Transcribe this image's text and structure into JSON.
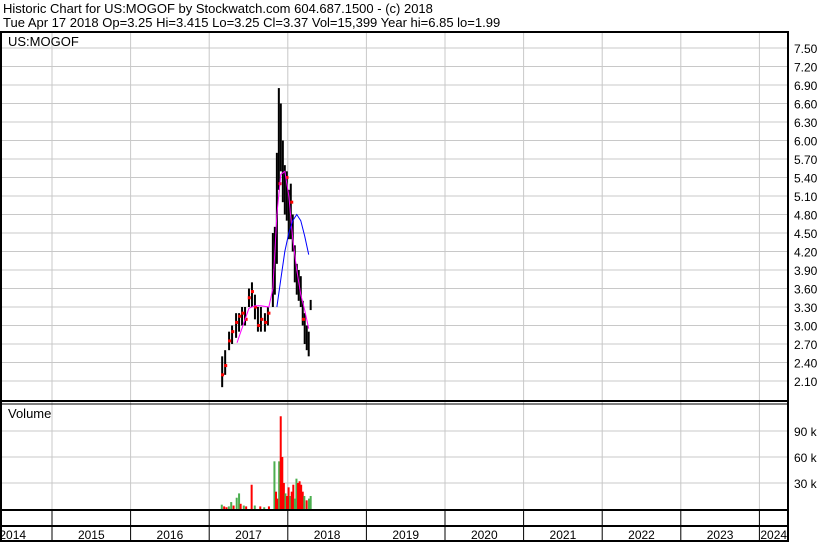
{
  "header": {
    "line1": "Historic Chart for US:MOGOF by Stockwatch.com 604.687.1500 - (c) 2018",
    "line2": "Tue Apr 17 2018  Op=3.25  Hi=3.415  Lo=3.25  Cl=3.37  Vol=15,399  Year hi=6.85  lo=1.99"
  },
  "chart_data": {
    "type": "line",
    "title": "US:MOGOF",
    "volume_title": "Volume",
    "colors": {
      "bar": "#000000",
      "dot": "#ff0000",
      "ma_short": "#ff00ff",
      "ma_long": "#0000ff",
      "vol_up": "#4caf50",
      "vol_down": "#ff0000",
      "grid": "#c8c8c8"
    },
    "price_ticks": [
      "7.50",
      "7.20",
      "6.90",
      "6.60",
      "6.30",
      "6.00",
      "5.70",
      "5.40",
      "5.10",
      "4.80",
      "4.50",
      "4.20",
      "3.90",
      "3.60",
      "3.30",
      "3.00",
      "2.70",
      "2.40",
      "2.10"
    ],
    "price_range": [
      1.95,
      7.5
    ],
    "volume_ticks": [
      {
        "v": 90,
        "label": "90 k"
      },
      {
        "v": 60,
        "label": "60 k"
      },
      {
        "v": 30,
        "label": "30 k"
      }
    ],
    "years": [
      "2014",
      "2015",
      "2016",
      "2017",
      "2018",
      "2019",
      "2020",
      "2021",
      "2022",
      "2023",
      "2024"
    ],
    "x_range": [
      2014.0,
      2024.35
    ],
    "price_bars": [
      [
        2017.165,
        2.5,
        2.0
      ],
      [
        2017.203,
        2.6,
        2.2
      ],
      [
        2017.253,
        2.9,
        2.6
      ],
      [
        2017.291,
        3.0,
        2.7
      ],
      [
        2017.342,
        3.2,
        2.8
      ],
      [
        2017.38,
        3.2,
        2.9
      ],
      [
        2017.418,
        3.3,
        3.0
      ],
      [
        2017.456,
        3.3,
        3.0
      ],
      [
        2017.506,
        3.6,
        3.3
      ],
      [
        2017.544,
        3.7,
        3.3
      ],
      [
        2017.582,
        3.5,
        3.1
      ],
      [
        2017.62,
        3.3,
        2.9
      ],
      [
        2017.658,
        3.3,
        2.9
      ],
      [
        2017.709,
        3.2,
        2.9
      ],
      [
        2017.747,
        3.3,
        3.0
      ],
      [
        2017.81,
        4.5,
        3.3
      ],
      [
        2017.835,
        4.6,
        3.5
      ],
      [
        2017.861,
        5.8,
        4.0
      ],
      [
        2017.886,
        6.85,
        5.2
      ],
      [
        2017.911,
        6.6,
        5.5
      ],
      [
        2017.937,
        6.0,
        5.0
      ],
      [
        2017.962,
        5.6,
        4.8
      ],
      [
        2017.987,
        5.5,
        4.7
      ],
      [
        2018.013,
        5.2,
        4.4
      ],
      [
        2018.038,
        5.3,
        4.4
      ],
      [
        2018.063,
        4.8,
        4.2
      ],
      [
        2018.089,
        4.3,
        3.7
      ],
      [
        2018.114,
        4.0,
        3.5
      ],
      [
        2018.139,
        3.9,
        3.4
      ],
      [
        2018.165,
        3.8,
        3.3
      ],
      [
        2018.19,
        3.4,
        3.0
      ],
      [
        2018.215,
        3.2,
        2.7
      ],
      [
        2018.241,
        3.0,
        2.6
      ],
      [
        2018.266,
        2.9,
        2.5
      ],
      [
        2018.291,
        3.415,
        3.25
      ]
    ],
    "red_dots": [
      [
        2017.17,
        2.2
      ],
      [
        2017.21,
        2.35
      ],
      [
        2017.26,
        2.75
      ],
      [
        2017.3,
        2.9
      ],
      [
        2017.35,
        3.05
      ],
      [
        2017.39,
        3.15
      ],
      [
        2017.43,
        3.2
      ],
      [
        2017.47,
        3.1
      ],
      [
        2017.51,
        3.45
      ],
      [
        2017.55,
        3.55
      ],
      [
        2017.59,
        3.3
      ],
      [
        2017.63,
        3.0
      ],
      [
        2017.67,
        3.1
      ],
      [
        2017.72,
        3.05
      ],
      [
        2017.76,
        3.2
      ],
      [
        2017.9,
        5.3
      ],
      [
        2017.99,
        5.4
      ],
      [
        2018.05,
        5.0
      ],
      [
        2018.2,
        3.1
      ]
    ],
    "ma_short": [
      [
        2017.354,
        2.72
      ],
      [
        2017.443,
        3.05
      ],
      [
        2017.506,
        3.28
      ],
      [
        2017.582,
        3.32
      ],
      [
        2017.658,
        3.32
      ],
      [
        2017.759,
        3.3
      ],
      [
        2017.81,
        3.6
      ],
      [
        2017.861,
        4.8
      ],
      [
        2017.911,
        5.45
      ],
      [
        2017.962,
        5.5
      ],
      [
        2018.013,
        5.1
      ],
      [
        2018.063,
        4.4
      ],
      [
        2018.114,
        3.9
      ],
      [
        2018.165,
        3.5
      ],
      [
        2018.215,
        3.25
      ],
      [
        2018.266,
        2.95
      ]
    ],
    "ma_long": [
      [
        2017.861,
        3.3
      ],
      [
        2017.911,
        3.75
      ],
      [
        2017.962,
        4.2
      ],
      [
        2018.013,
        4.5
      ],
      [
        2018.063,
        4.7
      ],
      [
        2018.114,
        4.8
      ],
      [
        2018.165,
        4.7
      ],
      [
        2018.215,
        4.45
      ],
      [
        2018.266,
        4.15
      ]
    ],
    "volume": [
      [
        2017.16,
        5,
        "up"
      ],
      [
        2017.19,
        3,
        "down"
      ],
      [
        2017.22,
        2,
        "down"
      ],
      [
        2017.25,
        3,
        "up"
      ],
      [
        2017.28,
        8,
        "up"
      ],
      [
        2017.31,
        4,
        "down"
      ],
      [
        2017.35,
        13,
        "up"
      ],
      [
        2017.38,
        18,
        "up"
      ],
      [
        2017.4,
        6,
        "down"
      ],
      [
        2017.44,
        4,
        "up"
      ],
      [
        2017.47,
        3,
        "down"
      ],
      [
        2017.54,
        28,
        "down"
      ],
      [
        2017.58,
        4,
        "up"
      ],
      [
        2017.65,
        3,
        "down"
      ],
      [
        2017.7,
        2,
        "up"
      ],
      [
        2017.76,
        3,
        "down"
      ],
      [
        2017.83,
        55,
        "up"
      ],
      [
        2017.85,
        20,
        "down"
      ],
      [
        2017.87,
        12,
        "down"
      ],
      [
        2017.89,
        55,
        "up"
      ],
      [
        2017.91,
        107,
        "down"
      ],
      [
        2017.93,
        60,
        "down"
      ],
      [
        2017.95,
        30,
        "down"
      ],
      [
        2017.97,
        18,
        "up"
      ],
      [
        2017.99,
        15,
        "down"
      ],
      [
        2018.01,
        25,
        "down"
      ],
      [
        2018.03,
        15,
        "up"
      ],
      [
        2018.05,
        20,
        "down"
      ],
      [
        2018.07,
        28,
        "down"
      ],
      [
        2018.09,
        12,
        "up"
      ],
      [
        2018.11,
        35,
        "up"
      ],
      [
        2018.13,
        30,
        "down"
      ],
      [
        2018.15,
        32,
        "down"
      ],
      [
        2018.17,
        28,
        "down"
      ],
      [
        2018.19,
        20,
        "down"
      ],
      [
        2018.21,
        15,
        "up"
      ],
      [
        2018.24,
        10,
        "down"
      ],
      [
        2018.27,
        12,
        "up"
      ],
      [
        2018.291,
        15,
        "up"
      ]
    ]
  }
}
